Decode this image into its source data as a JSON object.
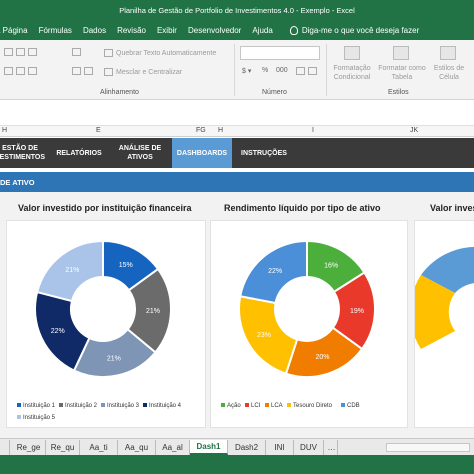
{
  "window_title": "Planilha de Gestão de Portfolio de Investimentos 4.0 - Exemplo  -  Excel",
  "ribbon_tabs": [
    "a Página",
    "Fórmulas",
    "Dados",
    "Revisão",
    "Exibir",
    "Desenvolvedor",
    "Ajuda"
  ],
  "tell_me": "Diga-me o que você deseja fazer",
  "ribbon": {
    "wrap_text": "Quebrar Texto Automaticamente",
    "merge_center": "Mesclar e Centralizar",
    "currency": "$",
    "percent": "%",
    "thousands": "000",
    "cond_format": "Formatação Condicional",
    "format_table": "Formatar como Tabela",
    "cell_styles": "Estilos de Célula",
    "group_alignment": "Alinhamento",
    "group_number": "Número",
    "group_styles": "Estilos"
  },
  "columns": [
    "H",
    "E",
    "FG",
    "H",
    "I",
    "JK"
  ],
  "nav": {
    "gestao": "ESTÃO DE\nVESTIMENTOS",
    "relatorios": "RELATÓRIOS",
    "analise": "ANÁLISE DE\nATIVOS",
    "dashboards": "DASHBOARDS",
    "instrucoes": "INSTRUÇÕES"
  },
  "section_title": "DE ATIVO",
  "chart_titles": [
    "Valor investido por instituição financeira",
    "Rendimento líquido por tipo de ativo",
    "Valor inves"
  ],
  "chart_data": [
    {
      "type": "pie",
      "title": "Valor investido por instituição financeira",
      "categories": [
        "Instituição 1",
        "Instituição 2",
        "Instituição 3",
        "Instituição 4",
        "Instituição 5"
      ],
      "values": [
        15,
        21,
        21,
        22,
        21
      ],
      "labels": [
        "15%",
        "21%",
        "21%",
        "22%",
        "21%"
      ],
      "colors": [
        "#1565c0",
        "#6b6b6b",
        "#7e95b5",
        "#0f2a66",
        "#a9c4e8"
      ],
      "legend_labels": [
        "Instituição 1",
        "Instituição 2",
        "Instituição 3",
        "Instituição 4",
        "Instituição 5"
      ],
      "legend_placement": "bottom"
    },
    {
      "type": "pie",
      "title": "Rendimento líquido por tipo de ativo",
      "categories": [
        "Ação",
        "LCI",
        "LCA",
        "Tesouro Direto",
        "CDB"
      ],
      "values": [
        16,
        19,
        20,
        23,
        22
      ],
      "labels": [
        "16%",
        "19%",
        "20%",
        "23%",
        "22%"
      ],
      "colors": [
        "#4caf3c",
        "#e8392a",
        "#f07d00",
        "#ffc000",
        "#4a8fd8"
      ],
      "legend_labels": [
        "Ação",
        "LCI",
        "LCA",
        "Tesouro Direto",
        "CDB"
      ],
      "legend_placement": "bottom"
    }
  ],
  "sheet_tabs": [
    "Re_ge",
    "Re_qu",
    "Aa_ti",
    "Aa_qu",
    "Aa_al",
    "Dash1",
    "Dash2",
    "INI",
    "DUV"
  ],
  "active_sheet": "Dash1"
}
